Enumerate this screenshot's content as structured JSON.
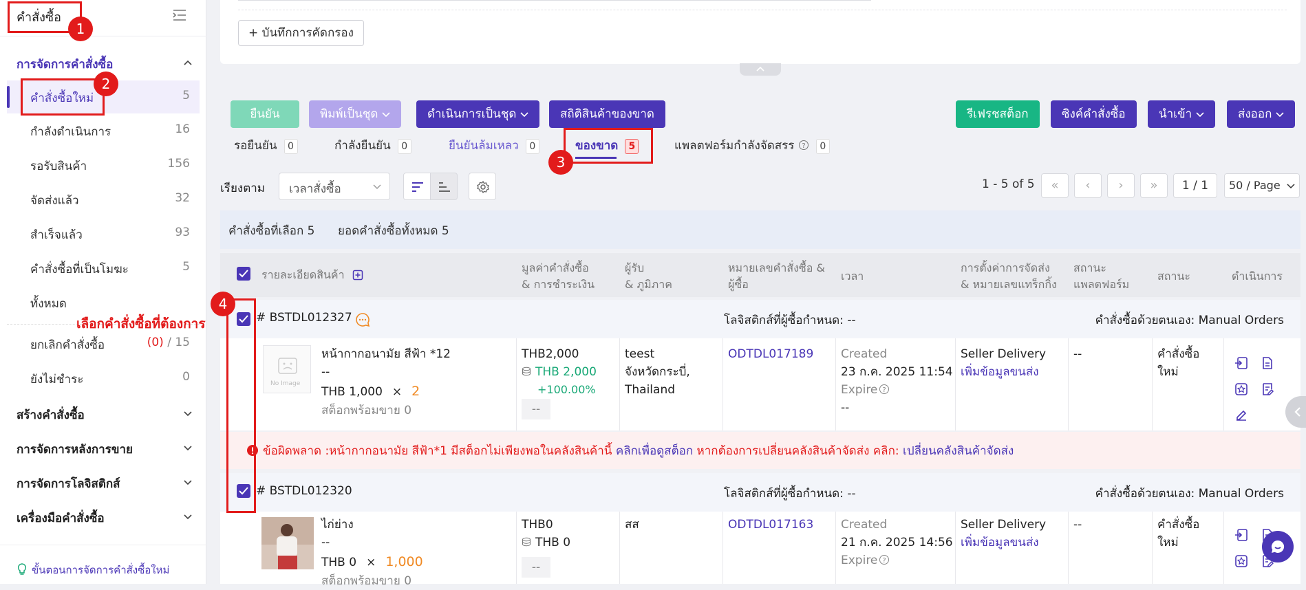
{
  "sidebar": {
    "title": "คำสั่งซื้อ",
    "groups": [
      {
        "label": "การจัดการคำสั่งซื้อ"
      },
      {
        "label": "สร้างคำสั่งซื้อ"
      },
      {
        "label": "การจัดการหลังการขาย"
      },
      {
        "label": "การจัดการโลจิสติกส์"
      },
      {
        "label": "เครื่องมือคำสั่งซื้อ"
      }
    ],
    "items": [
      {
        "label": "คำสั่งซื้อใหม่",
        "count": "5"
      },
      {
        "label": "กำลังดำเนินการ",
        "count": "16"
      },
      {
        "label": "รอรับสินค้า",
        "count": "156"
      },
      {
        "label": "จัดส่งแล้ว",
        "count": "32"
      },
      {
        "label": "สำเร็จแล้ว",
        "count": "93"
      },
      {
        "label": "คำสั่งซื้อที่เป็นโมฆะ",
        "count": "5"
      },
      {
        "label": "ทั้งหมด",
        "count": ""
      }
    ],
    "cancel": {
      "label": "ยกเลิกคำสั่งซื้อ",
      "count_red": "(0)",
      "sep": "/",
      "count": "15"
    },
    "unpaid": {
      "label": "ยังไม่ชำระ",
      "count": "0"
    },
    "footer": "ขั้นตอนการจัดการคำสั่งซื้อใหม่"
  },
  "annotations": {
    "n1": "1",
    "n2": "2",
    "n3": "3",
    "n4": "4",
    "note": "เลือกคำสั่งซื้อที่ต้องการ"
  },
  "filter": {
    "save_label": "+ บันทึกการคัดกรอง"
  },
  "toolbar": {
    "confirm": "ยืนยัน",
    "batch_print": "พิมพ์เป็นชุด",
    "batch_process": "ดำเนินการเป็นชุด",
    "oos_stats": "สถิติสินค้าของขาด",
    "refresh_stock": "รีเฟรชสต็อก",
    "sync_orders": "ซิงค์คำสั่งซื้อ",
    "import": "นำเข้า",
    "export": "ส่งออก"
  },
  "tabs": [
    {
      "label": "รอยืนยัน",
      "count": "0"
    },
    {
      "label": "กำลังยืนยัน",
      "count": "0"
    },
    {
      "label": "ยืนยันล้มเหลว",
      "count": "0"
    },
    {
      "label": "ของขาด",
      "count": "5"
    },
    {
      "label": "แพลตฟอร์มกำลังจัดสรร",
      "count": "0"
    }
  ],
  "sort": {
    "label": "เรียงตาม",
    "value": "เวลาสั่งซื้อ"
  },
  "pagination": {
    "range": "1 - 5 of 5",
    "page": "1 / 1",
    "per_page": "50 / Page"
  },
  "summary": {
    "selected": "คำสั่งซื้อที่เลือก 5",
    "total": "ยอดคำสั่งซื้อทั้งหมด 5"
  },
  "table": {
    "headers": {
      "product": "รายละเอียดสินค้า",
      "value1": "มูลค่าคำสั่งซื้อ",
      "value2": "& การชำระเงิน",
      "recv1": "ผู้รับ",
      "recv2": "& ภูมิภาค",
      "no1": "หมายเลขคำสั่งซื้อ &",
      "no2": "ผู้ซื้อ",
      "time": "เวลา",
      "ship1": "การตั้งค่าการจัดส่ง",
      "ship2": "& หมายเลขแทร็กกิ้ง",
      "pstatus1": "สถานะ",
      "pstatus2": "แพลตฟอร์ม",
      "status": "สถานะ",
      "action": "ดำเนินการ"
    },
    "orders": [
      {
        "id": "# BSTDL012327",
        "logistics": "โลจิสติกส์ที่ผู้ซื้อกำหนด: --",
        "source": "คำสั่งซื้อด้วยตนเอง: Manual Orders",
        "product_name": "หน้ากากอนามัย สีฟ้า *12",
        "sku": "--",
        "price": "THB 1,000",
        "times": "×",
        "qty": "2",
        "stock": "สต็อกพร้อมขาย 0",
        "total": "THB2,000",
        "paid": "THB 2,000",
        "pct": "+100.00%",
        "dash": "--",
        "recipient": "teest",
        "region1": "จังหวัดกระบี่,",
        "region2": "Thailand",
        "order_no": "ODTDL017189",
        "created_lbl": "Created",
        "created": "23 ก.ค. 2025 11:54",
        "expire_lbl": "Expire",
        "expire": "--",
        "ship_method": "Seller Delivery",
        "ship_link": "เพิ่มข้อมูลขนส่ง",
        "pstatus": "--",
        "status1": "คำสั่งซื้อ",
        "status2": "ใหม่",
        "no_image": "No Image"
      },
      {
        "id": "# BSTDL012320",
        "logistics": "โลจิสติกส์ที่ผู้ซื้อกำหนด: --",
        "source": "คำสั่งซื้อด้วยตนเอง: Manual Orders",
        "product_name": "ไก่ย่าง",
        "sku": "--",
        "price": "THB 0",
        "times": "×",
        "qty": "1,000",
        "stock": "สต็อกพร้อมขาย 0",
        "total": "THB0",
        "paid": "THB 0",
        "dash": "--",
        "recipient": "สส",
        "order_no": "ODTDL017163",
        "created_lbl": "Created",
        "created": "21 ก.ค. 2025 14:56",
        "expire_lbl": "Expire",
        "ship_method": "Seller Delivery",
        "ship_link": "เพิ่มข้อมูลขนส่ง",
        "pstatus": "--",
        "status1": "คำสั่งซื้อ",
        "status2": "ใหม่"
      }
    ],
    "error": {
      "prefix": "ข้อผิดพลาด :หน้ากากอนามัย สีฟ้า*1 มีสต็อกไม่เพียงพอในคลังสินค้านี้",
      "link1": "คลิกเพื่อดูสต็อก",
      "middle": "หากต้องการเปลี่ยนคลังสินค้าจัดส่ง คลิก:",
      "link2": "เปลี่ยนคลังสินค้าจัดส่ง"
    }
  },
  "colors": {
    "brand": "#4a36b6",
    "green": "#18a876",
    "red": "#e21b1b",
    "orange": "#f08a24"
  }
}
